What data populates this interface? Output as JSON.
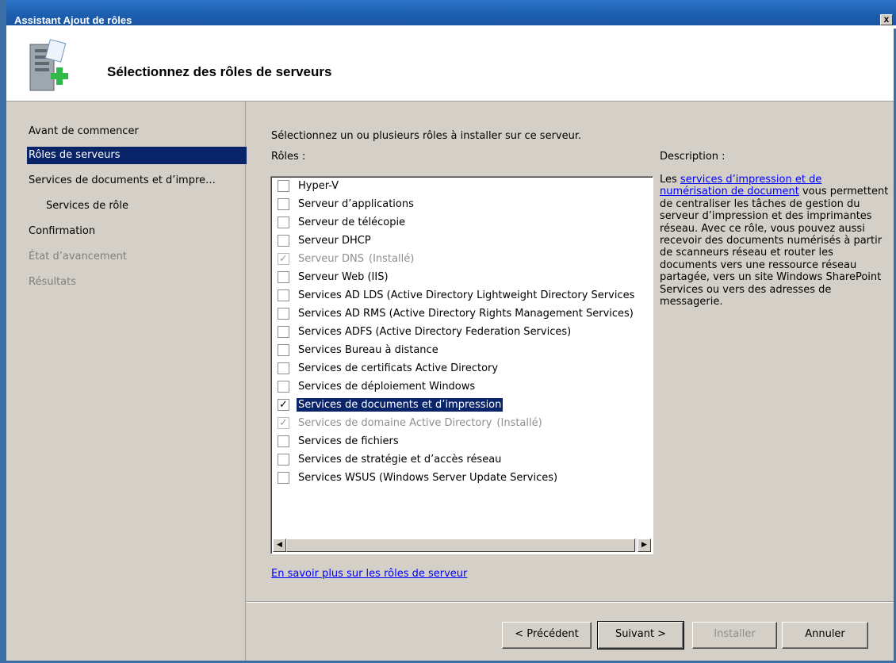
{
  "window": {
    "title": "Assistant Ajout de rôles",
    "close_glyph": "x"
  },
  "header": {
    "heading": "Sélectionnez des rôles de serveurs",
    "icon": "server-add-icon"
  },
  "nav": {
    "items": [
      {
        "label": "Avant de commencer",
        "state": "normal"
      },
      {
        "label": "Rôles de serveurs",
        "state": "selected"
      },
      {
        "label": "Services de documents et d’impre…",
        "state": "normal"
      },
      {
        "label": "Services de rôle",
        "state": "normal"
      },
      {
        "label": "Confirmation",
        "state": "normal"
      },
      {
        "label": "État d’avancement",
        "state": "disabled"
      },
      {
        "label": "Résultats",
        "state": "disabled"
      }
    ]
  },
  "main": {
    "intro": "Sélectionnez un ou plusieurs rôles à installer sur ce serveur.",
    "roles_label": "Rôles :",
    "description_label": "Description :",
    "roles": [
      {
        "label": "Hyper-V",
        "checked": false,
        "disabled": false
      },
      {
        "label": "Serveur d’applications",
        "checked": false,
        "disabled": false
      },
      {
        "label": "Serveur de télécopie",
        "checked": false,
        "disabled": false
      },
      {
        "label": "Serveur DHCP",
        "checked": false,
        "disabled": false
      },
      {
        "label": "Serveur DNS",
        "installed": "(Installé)",
        "checked": true,
        "disabled": true
      },
      {
        "label": "Serveur Web (IIS)",
        "checked": false,
        "disabled": false
      },
      {
        "label": "Services AD LDS (Active Directory Lightweight Directory Services",
        "checked": false,
        "disabled": false
      },
      {
        "label": "Services AD RMS (Active Directory Rights Management Services)",
        "checked": false,
        "disabled": false
      },
      {
        "label": "Services ADFS (Active Directory Federation Services)",
        "checked": false,
        "disabled": false
      },
      {
        "label": "Services Bureau à distance",
        "checked": false,
        "disabled": false
      },
      {
        "label": "Services de certificats Active Directory",
        "checked": false,
        "disabled": false
      },
      {
        "label": "Services de déploiement Windows",
        "checked": false,
        "disabled": false
      },
      {
        "label": "Services de documents et d’impression",
        "checked": true,
        "disabled": false,
        "selected": true
      },
      {
        "label": "Services de domaine Active Directory",
        "installed": "(Installé)",
        "checked": true,
        "disabled": true
      },
      {
        "label": "Services de fichiers",
        "checked": false,
        "disabled": false
      },
      {
        "label": "Services de stratégie et d’accès réseau",
        "checked": false,
        "disabled": false
      },
      {
        "label": "Services WSUS (Windows Server Update Services)",
        "checked": false,
        "disabled": false
      }
    ],
    "description": {
      "prefix": "Les ",
      "link": "services d’impression et de numérisation de document",
      "suffix": " vous permettent de centraliser les tâches de gestion du serveur d’impression et des imprimantes réseau. Avec ce rôle, vous pouvez aussi recevoir des documents numérisés à partir de scanneurs réseau et router les documents vers une ressource réseau partagée, vers un site Windows SharePoint Services ou vers des adresses de messagerie."
    },
    "learn_more": "En savoir plus sur les rôles de serveur"
  },
  "footer": {
    "previous": "< Précédent",
    "next": "Suivant >",
    "install": "Installer",
    "cancel": "Annuler"
  },
  "colors": {
    "title_bar": "#1d5fb0",
    "selection": "#0a246a",
    "dialog_bg": "#d4d0c8",
    "link": "#0000ff"
  }
}
